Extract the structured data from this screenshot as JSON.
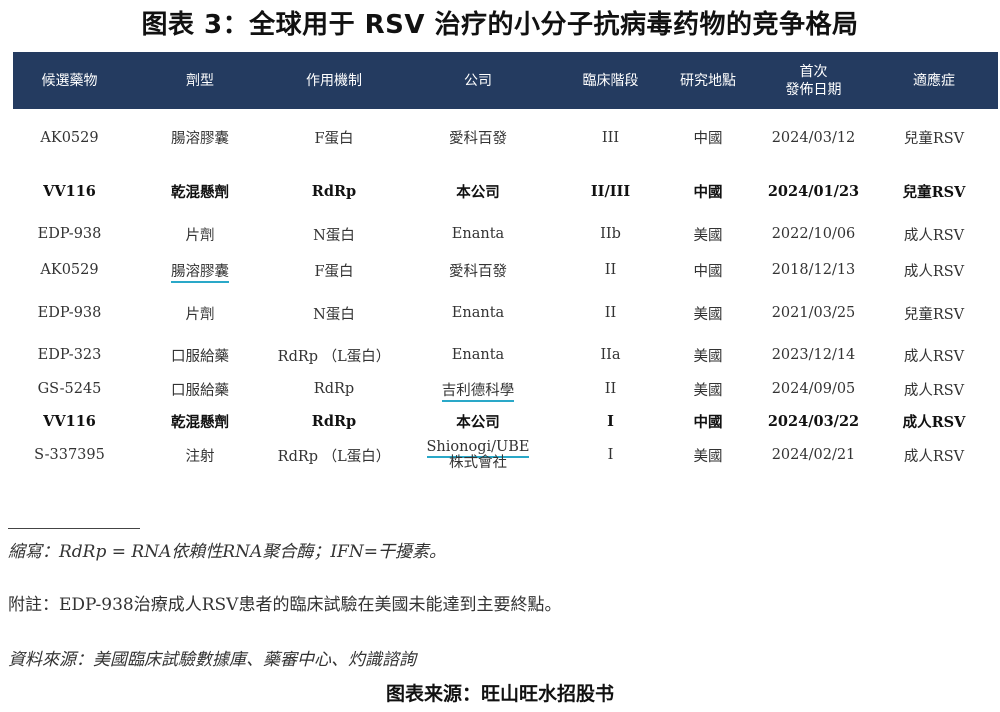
{
  "title": "图表 3：全球用于 RSV 治疗的小分子抗病毒药物的竞争格局",
  "table": {
    "headers": [
      "候選藥物",
      "劑型",
      "作用機制",
      "公司",
      "臨床階段",
      "研究地點",
      "首次\n發佈日期",
      "適應症"
    ],
    "header_first_date": "首次",
    "header_second_date": "發佈日期",
    "rows": [
      [
        "AK0529",
        "腸溶膠囊",
        "F蛋白",
        "愛科百發",
        "III",
        "中國",
        "2024/03/12",
        "兒童RSV"
      ],
      [
        "VV116",
        "乾混懸劑",
        "RdRp",
        "本公司",
        "II/III",
        "中國",
        "2024/01/23",
        "兒童RSV"
      ],
      [
        "EDP-938",
        "片劑",
        "N蛋白",
        "Enanta",
        "IIb",
        "美國",
        "2022/10/06",
        "成人RSV"
      ],
      [
        "AK0529",
        "腸溶膠囊",
        "F蛋白",
        "愛科百發",
        "II",
        "中國",
        "2018/12/13",
        "成人RSV"
      ],
      [
        "EDP-938",
        "片劑",
        "N蛋白",
        "Enanta",
        "II",
        "美國",
        "2021/03/25",
        "兒童RSV"
      ],
      [
        "EDP-323",
        "口服給藥",
        "RdRp （L蛋白）",
        "Enanta",
        "IIa",
        "美國",
        "2023/12/14",
        "成人RSV"
      ],
      [
        "GS-5245",
        "口服給藥",
        "RdRp",
        "吉利德科學",
        "II",
        "美國",
        "2024/09/05",
        "成人RSV"
      ],
      [
        "VV116",
        "乾混懸劑",
        "RdRp",
        "本公司",
        "I",
        "中國",
        "2024/03/22",
        "成人RSV"
      ],
      [
        "S-337395",
        "注射",
        "RdRp （L蛋白）",
        "Shionogi/UBE",
        "I",
        "美國",
        "2024/02/21",
        "成人RSV"
      ]
    ],
    "last_company_line2": "株式會社"
  },
  "notes": {
    "abbrev": "縮寫：RdRp = RNA依賴性RNA聚合酶；IFN=干擾素。",
    "remark": "附註：EDP-938治療成人RSV患者的臨床試驗在美國未能達到主要終點。",
    "data_source": "資料來源：美國臨床試驗數據庫、藥審中心、灼識諮詢"
  },
  "chart_source": "图表来源：旺山旺水招股书",
  "colors": {
    "header_bg": "#243b60",
    "underline": "#2aa8c8"
  }
}
